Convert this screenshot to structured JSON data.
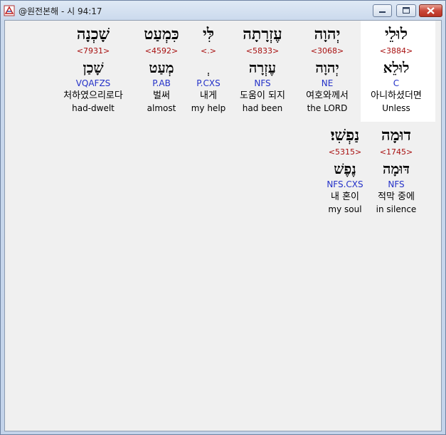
{
  "window": {
    "title": "@원전본해 - 시 94:17"
  },
  "colors": {
    "strong_number": "#a81010",
    "morphology": "#2330c8",
    "selected_cell_bg": "#ffffff"
  },
  "rows": [
    {
      "words": [
        {
          "heb": "לוּלֵי",
          "strong": "<3884>",
          "lemma": "לוּלֵא",
          "morph": "C",
          "korean": "아니하셨더면",
          "english": "Unless"
        },
        {
          "heb": "יְהוָה",
          "strong": "<3068>",
          "lemma": "יְהוָה",
          "morph": "NE",
          "korean": "여호와께서",
          "english": "the LORD"
        },
        {
          "heb": "עֶזְרָתָה",
          "strong": "<5833>",
          "lemma": "עֶזְרָה",
          "morph": "NFS",
          "korean": "도움이 되지",
          "english": "had been"
        },
        {
          "heb": "לִּי",
          "strong": "<.>",
          "lemma": "ְ",
          "morph": "P.CXS",
          "korean": "내게",
          "english": "my help"
        },
        {
          "heb": "כִּמְעַט",
          "strong": "<4592>",
          "lemma": "מְעַט",
          "morph": "P.AB",
          "korean": "벌써",
          "english": "almost"
        },
        {
          "heb": "שָׁכְנָה",
          "strong": "<7931>",
          "lemma": "שָׁכַן",
          "morph": "VQAFZS",
          "korean": "처하였으리로다",
          "english": "had-dwelt"
        }
      ]
    },
    {
      "words": [
        {
          "heb": "דוּמָה",
          "strong": "<1745>",
          "lemma": "דּוּמָה",
          "morph": "NFS",
          "korean": "적막 중에",
          "english": "in silence"
        },
        {
          "heb": "נַפְשִׁי׃",
          "strong": "<5315>",
          "lemma": "נֶפֶשׁ",
          "morph": "NFS.CXS",
          "korean": "내 혼이",
          "english": "my soul"
        }
      ]
    }
  ]
}
